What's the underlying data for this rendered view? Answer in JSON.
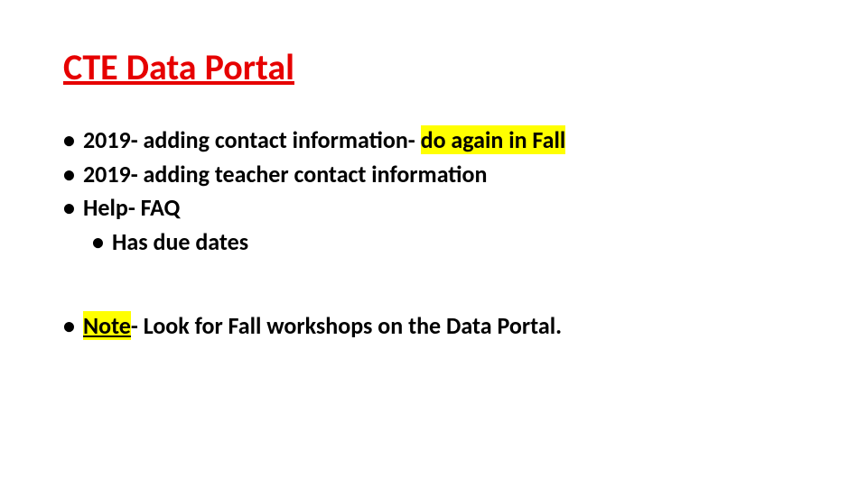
{
  "title": "CTE Data Portal",
  "bullets": {
    "item1_prefix": "2019- adding contact information- ",
    "item1_highlight": "do again in Fall ",
    "item2": "2019- adding teacher contact information",
    "item3": "Help- FAQ",
    "item3_sub": "Has due dates",
    "note_highlight": "Note",
    "note_suffix": "- Look for Fall workshops on the Data Portal."
  }
}
